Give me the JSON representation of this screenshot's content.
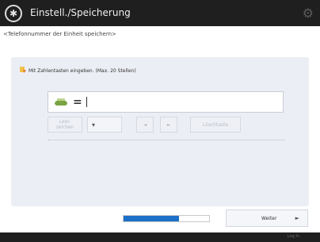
{
  "header": {
    "title": "Einstell./Speicherung"
  },
  "subtitle": "<Telefonnummer der Einheit speichern>",
  "instruction": "Mit Zahlentasten eingeben. (Max. 20 Stellen)",
  "input": {
    "prefix_symbol": "=",
    "value": ""
  },
  "controls": {
    "insert_label": "Leer- zeichen",
    "dropdown_symbol": "▾",
    "left_symbol": "◄",
    "right_symbol": "►",
    "backspace_label": "Löschtaste"
  },
  "progress": {
    "value": 0.65,
    "color": "#1d6fc7"
  },
  "next_button": {
    "label": "Weiter",
    "arrow": "►"
  },
  "footer": {
    "label": "Log In"
  },
  "colors": {
    "titlebar": "#1f1f1f",
    "panel": "#eceef5",
    "accent": "#1d6fc7"
  }
}
